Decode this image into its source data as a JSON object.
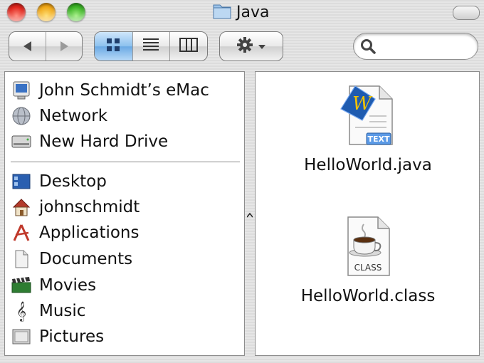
{
  "window": {
    "title": "Java",
    "title_icon": "folder-icon"
  },
  "toolbar": {
    "back_icon": "back-arrow-icon",
    "forward_icon": "forward-arrow-icon",
    "views": [
      "icon-view-icon",
      "list-view-icon",
      "column-view-icon"
    ],
    "active_view": "icon-view-icon",
    "action_icon": "gear-icon",
    "search_icon": "search-icon",
    "search_value": ""
  },
  "sidebar": {
    "devices": [
      {
        "label": "John Schmidt’s eMac",
        "icon": "computer-icon"
      },
      {
        "label": "Network",
        "icon": "network-globe-icon"
      },
      {
        "label": "New Hard Drive",
        "icon": "hard-drive-icon"
      }
    ],
    "places": [
      {
        "label": "Desktop",
        "icon": "desktop-icon"
      },
      {
        "label": "johnschmidt",
        "icon": "home-icon"
      },
      {
        "label": "Applications",
        "icon": "applications-icon"
      },
      {
        "label": "Documents",
        "icon": "documents-icon"
      },
      {
        "label": "Movies",
        "icon": "movies-icon"
      },
      {
        "label": "Music",
        "icon": "music-icon"
      },
      {
        "label": "Pictures",
        "icon": "pictures-icon"
      }
    ]
  },
  "files": [
    {
      "name": "HelloWorld.java",
      "icon": "java-text-file-icon",
      "badge": "TEXT"
    },
    {
      "name": "HelloWorld.class",
      "icon": "java-class-file-icon",
      "badge": "CLASS"
    }
  ],
  "colors": {
    "selected_view": "#8cc1ee",
    "close": "#e0251c",
    "minimize": "#f0a818",
    "zoom": "#3db526"
  }
}
